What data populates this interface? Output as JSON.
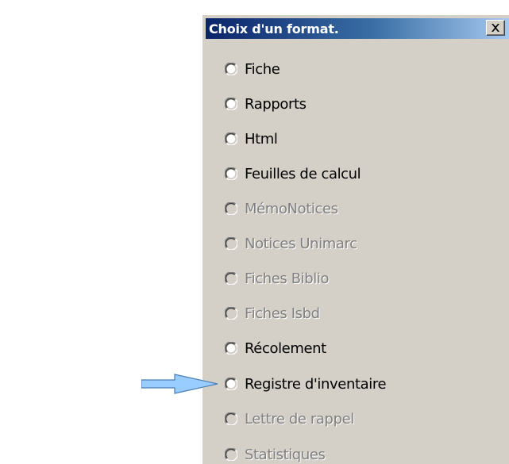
{
  "window": {
    "title": "Choix d'un format.",
    "close_icon": "close-x-icon"
  },
  "options": [
    {
      "label": "Fiche",
      "enabled": true,
      "selected": false
    },
    {
      "label": "Rapports",
      "enabled": true,
      "selected": false
    },
    {
      "label": "Html",
      "enabled": true,
      "selected": false
    },
    {
      "label": "Feuilles de calcul",
      "enabled": true,
      "selected": false
    },
    {
      "label": "MémoNotices",
      "enabled": false,
      "selected": false
    },
    {
      "label": "Notices Unimarc",
      "enabled": false,
      "selected": false
    },
    {
      "label": "Fiches Biblio",
      "enabled": false,
      "selected": false
    },
    {
      "label": "Fiches Isbd",
      "enabled": false,
      "selected": false
    },
    {
      "label": "Récolement",
      "enabled": true,
      "selected": false
    },
    {
      "label": "Registre d'inventaire",
      "enabled": true,
      "selected": false
    },
    {
      "label": "Lettre de rappel",
      "enabled": false,
      "selected": false
    },
    {
      "label": "Statistiques",
      "enabled": false,
      "selected": false
    }
  ],
  "annotation": {
    "arrow_icon": "arrow-right-icon",
    "points_to": "Registre d'inventaire",
    "color": "#99ccff"
  },
  "colors": {
    "dialog_bg": "#d4d0c8",
    "title_gradient_start": "#0a246a",
    "title_gradient_end": "#a6caf0",
    "disabled_text": "#808080"
  }
}
